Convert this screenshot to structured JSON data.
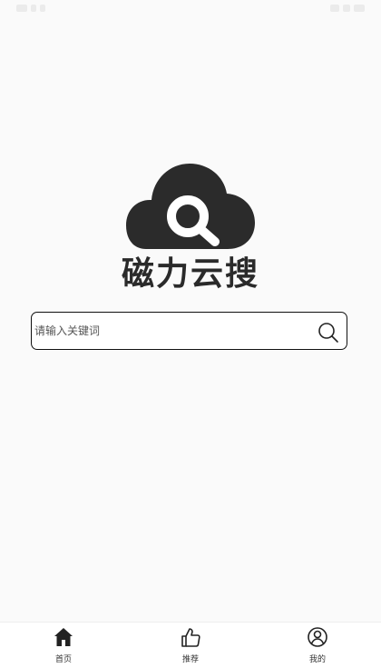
{
  "header": {
    "app_title": "磁力云搜"
  },
  "search": {
    "placeholder": "请输入关键词"
  },
  "bottom_nav": {
    "items": [
      {
        "label": "首页",
        "icon": "home-icon",
        "active": true
      },
      {
        "label": "推荐",
        "icon": "thumbs-up-icon",
        "active": false
      },
      {
        "label": "我的",
        "icon": "user-icon",
        "active": false
      }
    ]
  },
  "colors": {
    "primary": "#2a2a2a",
    "background": "#fafafa",
    "border": "#111111"
  }
}
